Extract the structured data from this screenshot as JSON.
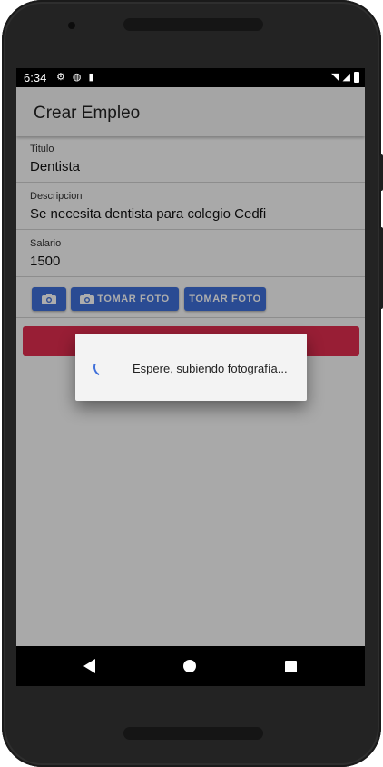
{
  "status_bar": {
    "time": "6:34",
    "left_icons": [
      "gear-icon",
      "sim-alert-icon",
      "sd-card-icon"
    ],
    "right_icons": [
      "wifi-icon",
      "signal-icon",
      "battery-icon"
    ]
  },
  "app_bar": {
    "title": "Crear Empleo"
  },
  "form": {
    "fields": [
      {
        "label": "Titulo",
        "value": "Dentista"
      },
      {
        "label": "Descripcion",
        "value": "Se necesita dentista para colegio Cedfi"
      },
      {
        "label": "Salario",
        "value": "1500"
      }
    ],
    "buttons": [
      {
        "label": "",
        "icon": "camera-icon"
      },
      {
        "label": "TOMAR FOTO",
        "icon": "camera-icon"
      },
      {
        "label": "TOMAR FOTO"
      }
    ]
  },
  "dialog": {
    "message": "Espere, subiendo fotografía..."
  },
  "colors": {
    "primary_button": "#3f6fd9",
    "submit_button": "#e02d4f",
    "app_bar": "#f4f4f4"
  }
}
